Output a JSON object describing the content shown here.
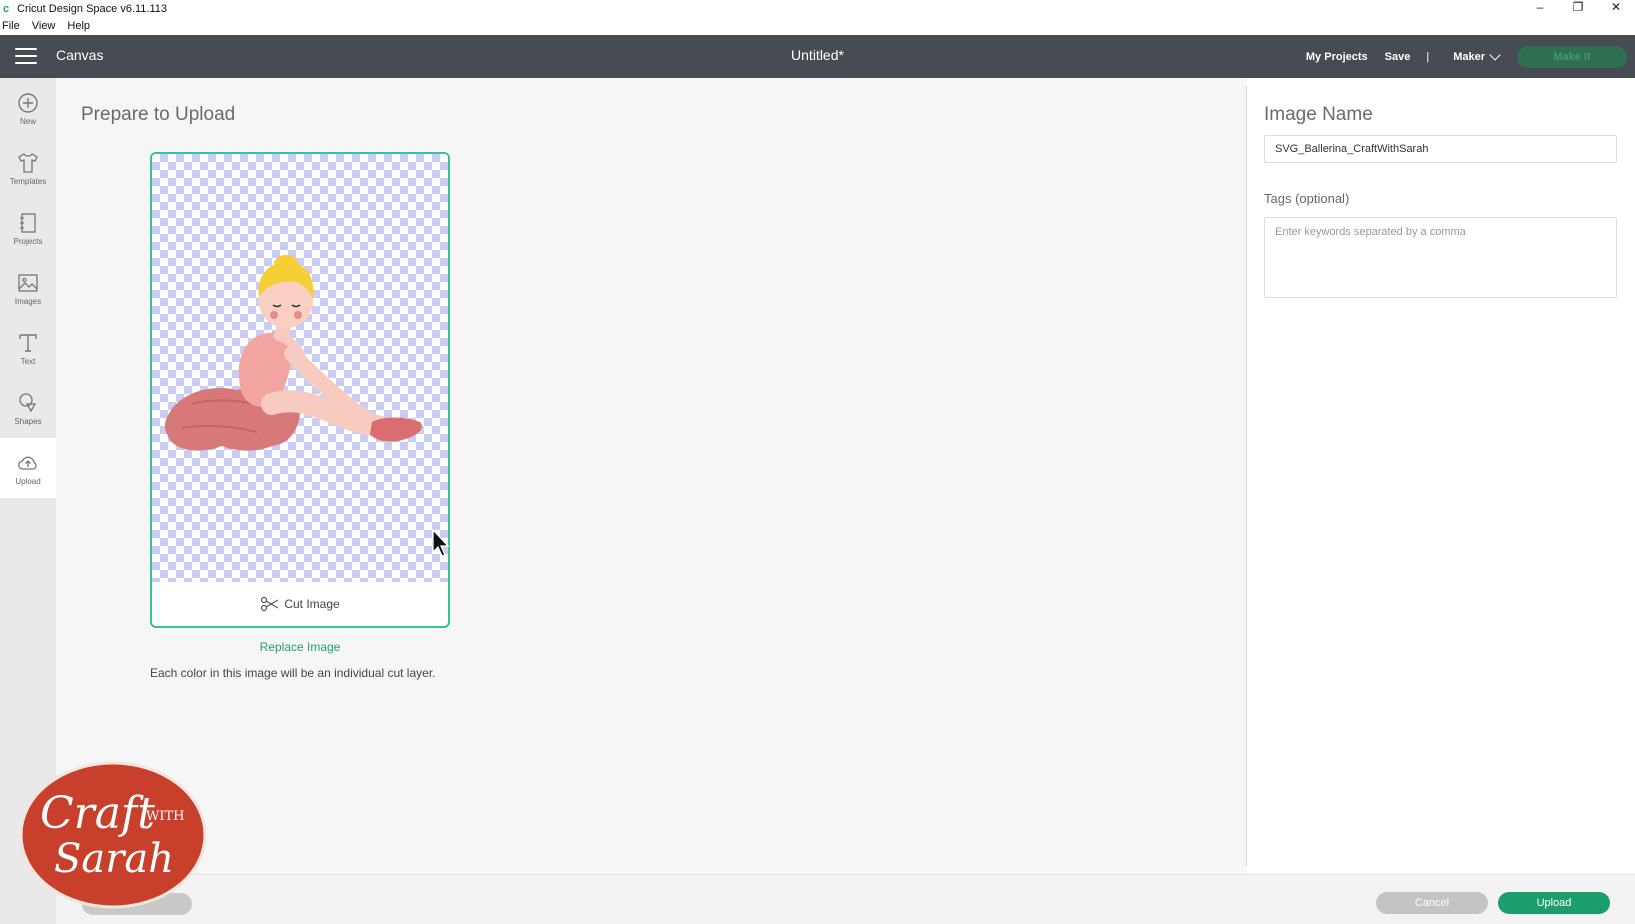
{
  "os_window": {
    "app_title": "Cricut Design Space  v6.11.113",
    "controls": [
      "–",
      "❐",
      "✕"
    ]
  },
  "menubar": {
    "items": [
      "File",
      "View",
      "Help"
    ]
  },
  "header": {
    "section": "Canvas",
    "document_title": "Untitled*",
    "my_projects": "My Projects",
    "save": "Save",
    "separator": "|",
    "machine": "Maker",
    "make_it": "Make It"
  },
  "sidebar": {
    "items": [
      {
        "label": "New",
        "icon": "plus-circle-icon"
      },
      {
        "label": "Templates",
        "icon": "tshirt-icon"
      },
      {
        "label": "Projects",
        "icon": "notebook-icon"
      },
      {
        "label": "Images",
        "icon": "image-icon"
      },
      {
        "label": "Text",
        "icon": "text-t-icon"
      },
      {
        "label": "Shapes",
        "icon": "shapes-icon"
      },
      {
        "label": "Upload",
        "icon": "cloud-upload-icon"
      }
    ],
    "active": "Upload"
  },
  "main": {
    "heading": "Prepare to Upload",
    "cut_image_label": "Cut Image",
    "replace_link": "Replace Image",
    "info_text": "Each color in this image will be an individual cut layer."
  },
  "right_panel": {
    "image_name_label": "Image Name",
    "image_name_value": "SVG_Ballerina_CraftWithSarah",
    "tags_label": "Tags (optional)",
    "tags_placeholder": "Enter keywords separated by a comma"
  },
  "footer": {
    "cancel": "Cancel",
    "upload": "Upload"
  },
  "watermark": {
    "text_line1": "Craft",
    "text_with": "WITH",
    "text_line2": "Sarah"
  },
  "colors": {
    "header_bg": "#464c52",
    "accent_green": "#1c9e6c",
    "card_border": "#3bbf95",
    "checker": "#c9ccf3",
    "watermark_red": "#c8402b"
  }
}
